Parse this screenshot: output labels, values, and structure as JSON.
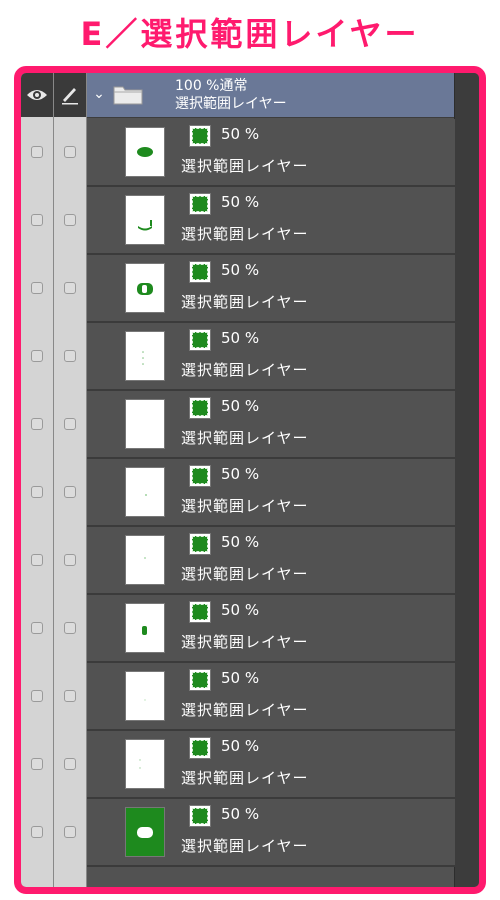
{
  "page_title": "E／選択範囲レイヤー",
  "folder": {
    "opacity_blend": "100 %通常",
    "name": "選択範囲レイヤー"
  },
  "layers": [
    {
      "opacity": "50 %",
      "name": "選択範囲レイヤー",
      "thumb": "blob"
    },
    {
      "opacity": "50 %",
      "name": "選択範囲レイヤー",
      "thumb": "mouth"
    },
    {
      "opacity": "50 %",
      "name": "選択範囲レイヤー",
      "thumb": "eye"
    },
    {
      "opacity": "50 %",
      "name": "選択範囲レイヤー",
      "thumb": "dots"
    },
    {
      "opacity": "50 %",
      "name": "選択範囲レイヤー",
      "thumb": "blank"
    },
    {
      "opacity": "50 %",
      "name": "選択範囲レイヤー",
      "thumb": "speck"
    },
    {
      "opacity": "50 %",
      "name": "選択範囲レイヤー",
      "thumb": "speck2"
    },
    {
      "opacity": "50 %",
      "name": "選択範囲レイヤー",
      "thumb": "bar"
    },
    {
      "opacity": "50 %",
      "name": "選択範囲レイヤー",
      "thumb": "faint"
    },
    {
      "opacity": "50 %",
      "name": "選択範囲レイヤー",
      "thumb": "dots2"
    },
    {
      "opacity": "50 %",
      "name": "選択範囲レイヤー",
      "thumb": "green"
    }
  ],
  "colors": {
    "accent": "#ff1a6e",
    "selection_green": "#1e8a1e",
    "folder_bg": "#6a7897",
    "panel_bg": "#525252"
  },
  "icons": {
    "visibility": "eye-icon",
    "lock": "pen-icon",
    "folder": "folder-icon",
    "mask": "selection-mask-icon"
  }
}
